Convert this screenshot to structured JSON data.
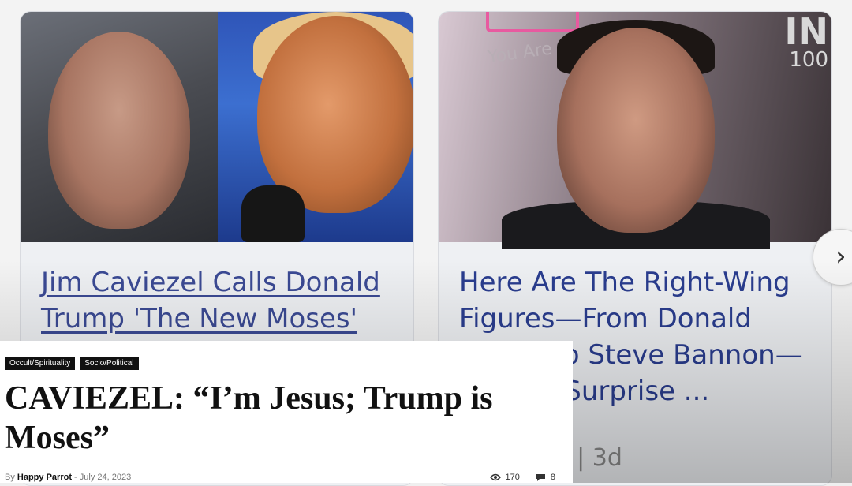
{
  "carousel": {
    "cards": [
      {
        "title": "Jim Caviezel Calls Donald Trump 'The New Moses'"
      },
      {
        "title": "Here Are The Right-Wing Figures—From Donald Trump To Steve Bannon—Making Surprise ...",
        "meta": "s | 3d",
        "image_text": "You Are",
        "corner_big": "IN",
        "corner_small": "100"
      }
    ],
    "next_icon": "chevron-right-icon"
  },
  "article": {
    "tags": [
      "Occult/Spirituality",
      "Socio/Political"
    ],
    "headline": "CAVIEZEL: “I’m Jesus; Trump is Moses”",
    "byline_prefix": "By",
    "author": "Happy Parrot",
    "separator": "-",
    "date": "July 24, 2023",
    "views": "170",
    "comments": "8"
  },
  "colors": {
    "link": "#3b4a94",
    "tag_bg": "#111111",
    "headline": "#111111"
  }
}
